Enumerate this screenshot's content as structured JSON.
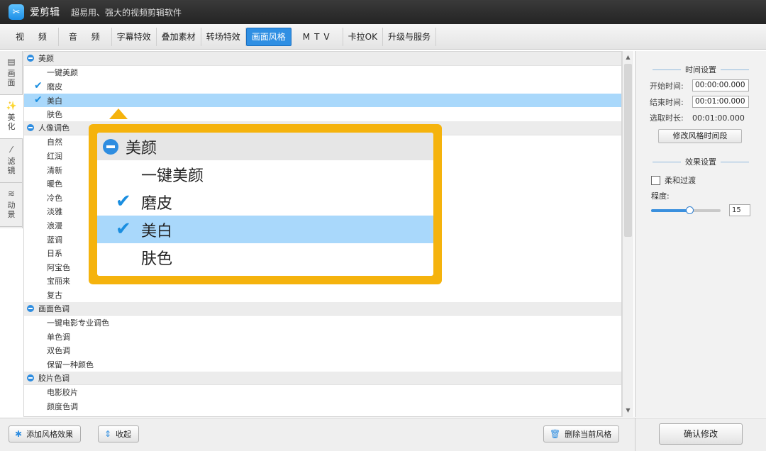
{
  "titlebar": {
    "app_name": "爱剪辑",
    "slogan": "超易用、强大的视频剪辑软件"
  },
  "tabs": [
    {
      "label": "视 频",
      "active": false
    },
    {
      "label": "音 频",
      "active": false
    },
    {
      "label": "字幕特效",
      "active": false
    },
    {
      "label": "叠加素材",
      "active": false
    },
    {
      "label": "转场特效",
      "active": false
    },
    {
      "label": "画面风格",
      "active": true
    },
    {
      "label": "MTV",
      "active": false
    },
    {
      "label": "卡拉OK",
      "active": false
    },
    {
      "label": "升级与服务",
      "active": false
    }
  ],
  "vtabs": [
    {
      "label": "画面",
      "icon": "film-icon"
    },
    {
      "label": "美化",
      "icon": "magic-wand-icon"
    },
    {
      "label": "滤镜",
      "icon": "wand-icon"
    },
    {
      "label": "动景",
      "icon": "layers-icon"
    }
  ],
  "list": {
    "groups": [
      {
        "name": "美颜",
        "items": [
          {
            "label": "一键美颜",
            "checked": false,
            "selected": false
          },
          {
            "label": "磨皮",
            "checked": true,
            "selected": false
          },
          {
            "label": "美白",
            "checked": true,
            "selected": true
          },
          {
            "label": "肤色",
            "checked": false,
            "selected": false
          }
        ]
      },
      {
        "name": "人像调色",
        "items": [
          {
            "label": "自然"
          },
          {
            "label": "红润"
          },
          {
            "label": "清新"
          },
          {
            "label": "暖色"
          },
          {
            "label": "冷色"
          },
          {
            "label": "淡雅"
          },
          {
            "label": "浪漫"
          },
          {
            "label": "蓝调"
          },
          {
            "label": "日系"
          },
          {
            "label": "阿宝色"
          },
          {
            "label": "宝丽来"
          },
          {
            "label": "复古"
          }
        ]
      },
      {
        "name": "画面色调",
        "items": [
          {
            "label": "一键电影专业调色"
          },
          {
            "label": "单色调"
          },
          {
            "label": "双色调"
          },
          {
            "label": "保留一种颜色"
          }
        ]
      },
      {
        "name": "胶片色调",
        "items": [
          {
            "label": "电影胶片"
          },
          {
            "label": "颜度色调"
          }
        ]
      }
    ]
  },
  "right": {
    "time_title": "时间设置",
    "start_label": "开始时间:",
    "start_value": "00:00:00.000",
    "end_label": "结束时间:",
    "end_value": "00:01:00.000",
    "duration_label": "选取时长:",
    "duration_value": "00:01:00.000",
    "modify_button": "修改风格时间段",
    "effect_title": "效果设置",
    "soft_transition_label": "柔和过渡",
    "degree_label": "程度:",
    "degree_value": "15",
    "degree_fraction": 0.55
  },
  "bottom": {
    "add_button": "添加风格效果",
    "collapse_button": "收起",
    "delete_button": "删除当前风格",
    "confirm_button": "确认修改"
  },
  "callout": {
    "group": "美颜",
    "items": [
      {
        "label": "一键美颜",
        "checked": false,
        "selected": false
      },
      {
        "label": "磨皮",
        "checked": true,
        "selected": false
      },
      {
        "label": "美白",
        "checked": true,
        "selected": true
      },
      {
        "label": "肤色",
        "checked": false,
        "selected": false
      }
    ]
  },
  "colors": {
    "accent": "#2f8fe3",
    "selection": "#a9d8fb",
    "callout": "#f5b30d",
    "titlebar": "#2b2b2b"
  }
}
